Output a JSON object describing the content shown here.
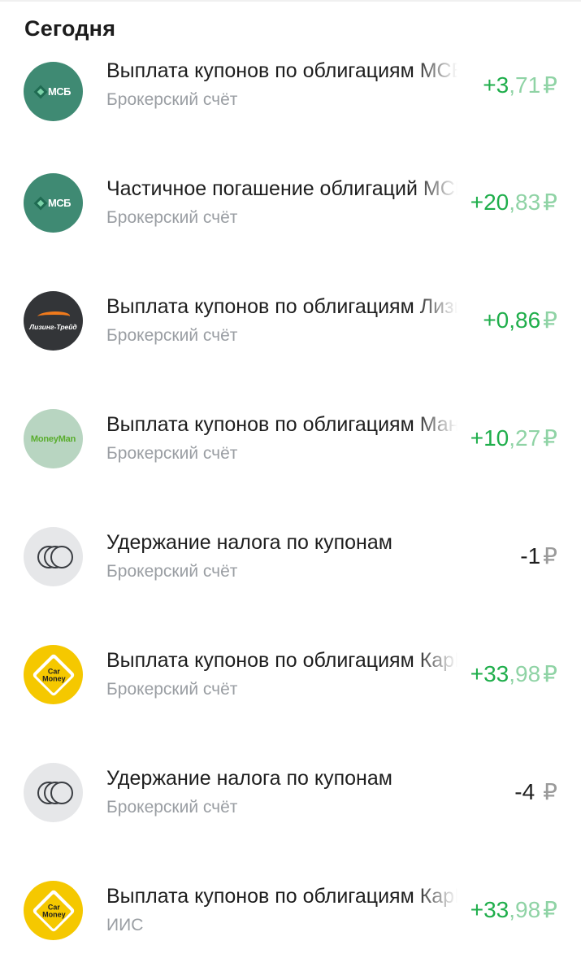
{
  "section_title": "Сегодня",
  "operations": [
    {
      "title": "Выплата купонов по облигациям МСБ-Лизинг",
      "account": "Брокерский счёт",
      "amount_int": "+3",
      "amount_frac": ",71",
      "currency": "₽",
      "sign": "pos",
      "logo": "msb-logo",
      "logo_text": "МСБ"
    },
    {
      "title": "Частичное погашение облигаций МСБ-Лизинг",
      "account": "Брокерский счёт",
      "amount_int": "+20",
      "amount_frac": ",83",
      "currency": "₽",
      "sign": "pos",
      "logo": "msb-logo",
      "logo_text": "МСБ"
    },
    {
      "title": "Выплата купонов по облигациям Лизинг-Трейд",
      "account": "Брокерский счёт",
      "amount_int": "+0,86",
      "amount_frac": "",
      "currency": "₽",
      "sign": "pos",
      "logo": "leasing-trade-logo",
      "logo_text": "Лизинг-Трейд"
    },
    {
      "title": "Выплата купонов по облигациям МаниМэн",
      "account": "Брокерский счёт",
      "amount_int": "+10",
      "amount_frac": ",27",
      "currency": "₽",
      "sign": "pos",
      "logo": "moneyman-logo",
      "logo_text": "MoneyMan"
    },
    {
      "title": "Удержание налога по купонам",
      "account": "Брокерский счёт",
      "amount_int": "-1",
      "amount_frac": "",
      "currency": "₽",
      "sign": "neg",
      "logo": "coins-icon",
      "logo_text": ""
    },
    {
      "title": "Выплата купонов по облигациям КарМани",
      "account": "Брокерский счёт",
      "amount_int": "+33",
      "amount_frac": ",98",
      "currency": "₽",
      "sign": "pos",
      "logo": "carmoney-logo",
      "logo_text": "Car Money"
    },
    {
      "title": "Удержание налога по купонам",
      "account": "Брокерский счёт",
      "amount_int": "-4",
      "amount_frac": "",
      "currency": "₽",
      "sign": "neg",
      "logo": "coins-icon",
      "logo_text": ""
    },
    {
      "title": "Выплата купонов по облигациям КарМани",
      "account": "ИИС",
      "amount_int": "+33",
      "amount_frac": ",98",
      "currency": "₽",
      "sign": "pos",
      "logo": "carmoney-logo",
      "logo_text": "Car Money"
    }
  ]
}
